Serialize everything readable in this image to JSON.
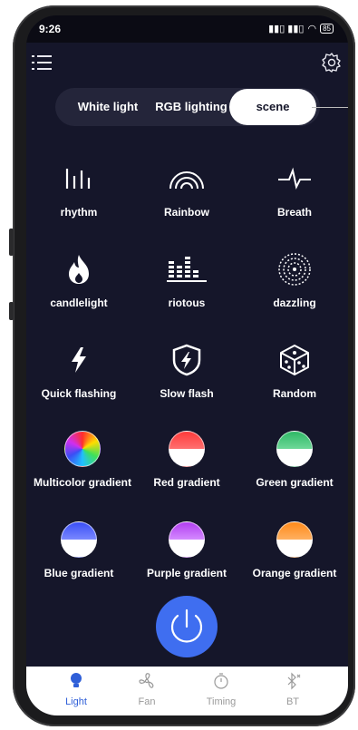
{
  "status": {
    "time": "9:26",
    "signal": "ᴹᴵᴸ ᴹᴵᴸ",
    "wifi": "wifi",
    "battery": "85"
  },
  "tabs": {
    "white": "White light",
    "rgb": "RGB lighting",
    "scene": "scene",
    "active": "scene"
  },
  "scenes": [
    {
      "label": "rhythm",
      "icon": "rhythm-icon"
    },
    {
      "label": "Rainbow",
      "icon": "rainbow-icon"
    },
    {
      "label": "Breath",
      "icon": "breath-icon"
    },
    {
      "label": "candlelight",
      "icon": "flame-icon"
    },
    {
      "label": "riotous",
      "icon": "equalizer-icon"
    },
    {
      "label": "dazzling",
      "icon": "dazzling-icon"
    },
    {
      "label": "Quick flashing",
      "icon": "lightning-icon"
    },
    {
      "label": "Slow flash",
      "icon": "shield-lightning-icon"
    },
    {
      "label": "Random",
      "icon": "dice-icon"
    },
    {
      "label": "Multicolor gradient",
      "icon": "multicolor-circle-icon"
    },
    {
      "label": "Red gradient",
      "icon": "red-circle-icon"
    },
    {
      "label": "Green gradient",
      "icon": "green-circle-icon"
    },
    {
      "label": "Blue gradient",
      "icon": "blue-circle-icon"
    },
    {
      "label": "Purple gradient",
      "icon": "purple-circle-icon"
    },
    {
      "label": "Orange gradient",
      "icon": "orange-circle-icon"
    }
  ],
  "nav": {
    "light": "Light",
    "fan": "Fan",
    "timing": "Timing",
    "bt": "BT",
    "active": "Light"
  },
  "colors": {
    "background": "#15162a",
    "accent": "#3f6ef0",
    "red": "#ff4040",
    "green": "#3ec46d",
    "blue": "#3a4ef5",
    "purple": "#b23ef0",
    "orange": "#ff8a1a"
  }
}
